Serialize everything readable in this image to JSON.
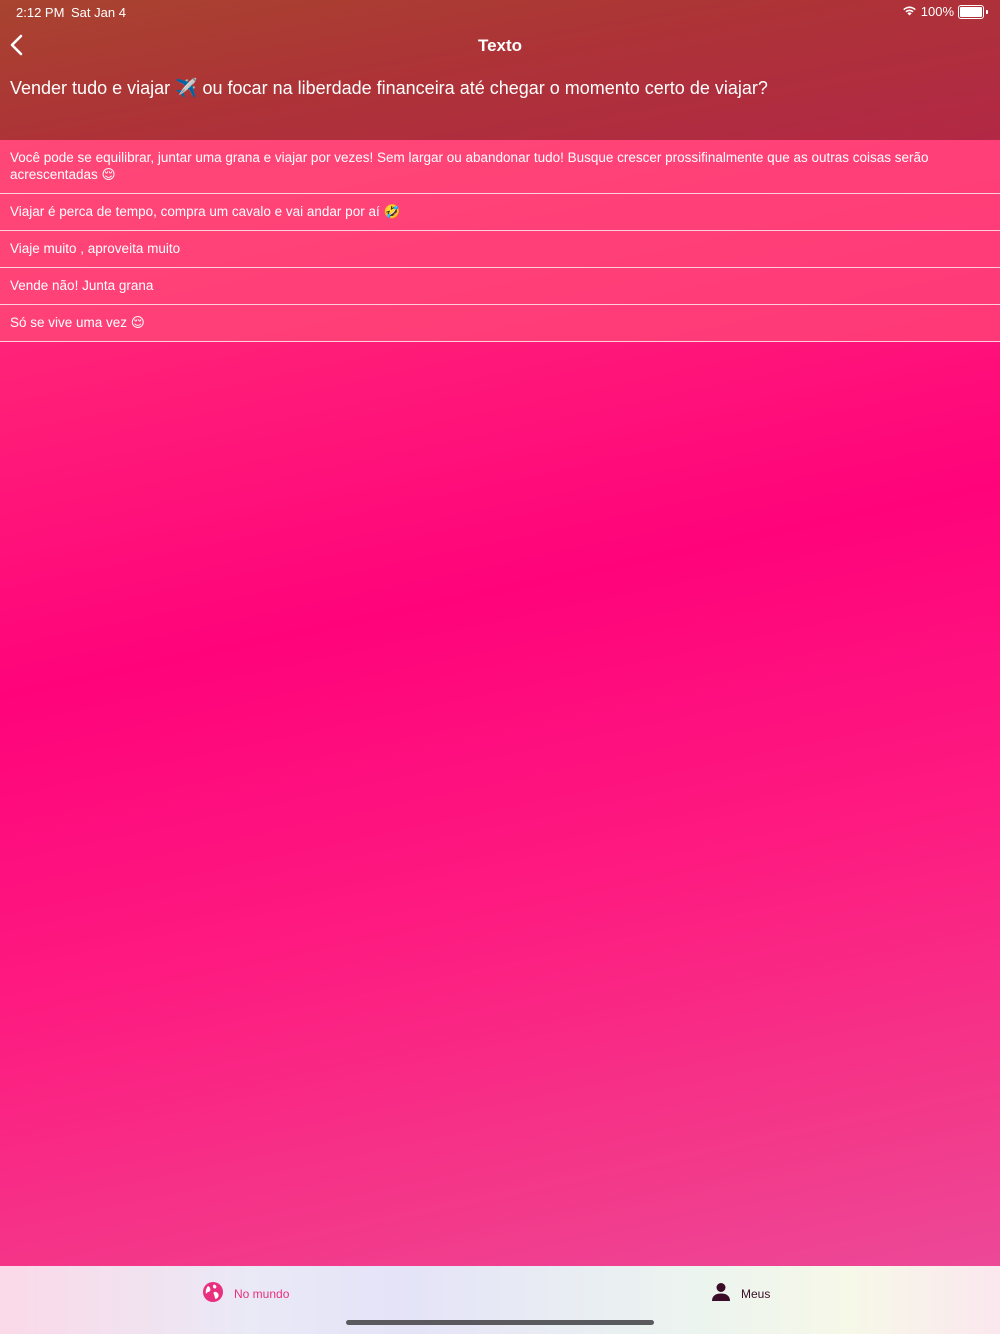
{
  "status_bar": {
    "time": "2:12 PM",
    "date": "Sat Jan 4",
    "battery_percent": "100%",
    "battery_level": 1.0
  },
  "nav": {
    "title": "Texto",
    "back_icon": "chevron-left-icon"
  },
  "question": "Vender tudo e viajar ✈️ ou focar na liberdade financeira até chegar o momento certo de viajar?",
  "answers": [
    "Você pode se equilibrar, juntar uma grana e viajar por vezes! Sem largar ou abandonar tudo! Busque crescer prossifinalmente que as outras coisas serão acrescentadas 😌",
    "Viajar é perca de tempo, compra um cavalo e vai andar por aí 🤣",
    "Viaje muito , aproveita muito",
    "Vende não! Junta grana",
    "Só se vive uma vez 😌"
  ],
  "tabs": [
    {
      "label": "No mundo",
      "icon": "globe-icon",
      "selected": true
    },
    {
      "label": "Meus",
      "icon": "person-icon",
      "selected": false
    }
  ],
  "colors": {
    "accent": "#e8307f",
    "header": "#ad3337",
    "background": "#ff037b",
    "tab_inactive": "#3a0c28"
  }
}
